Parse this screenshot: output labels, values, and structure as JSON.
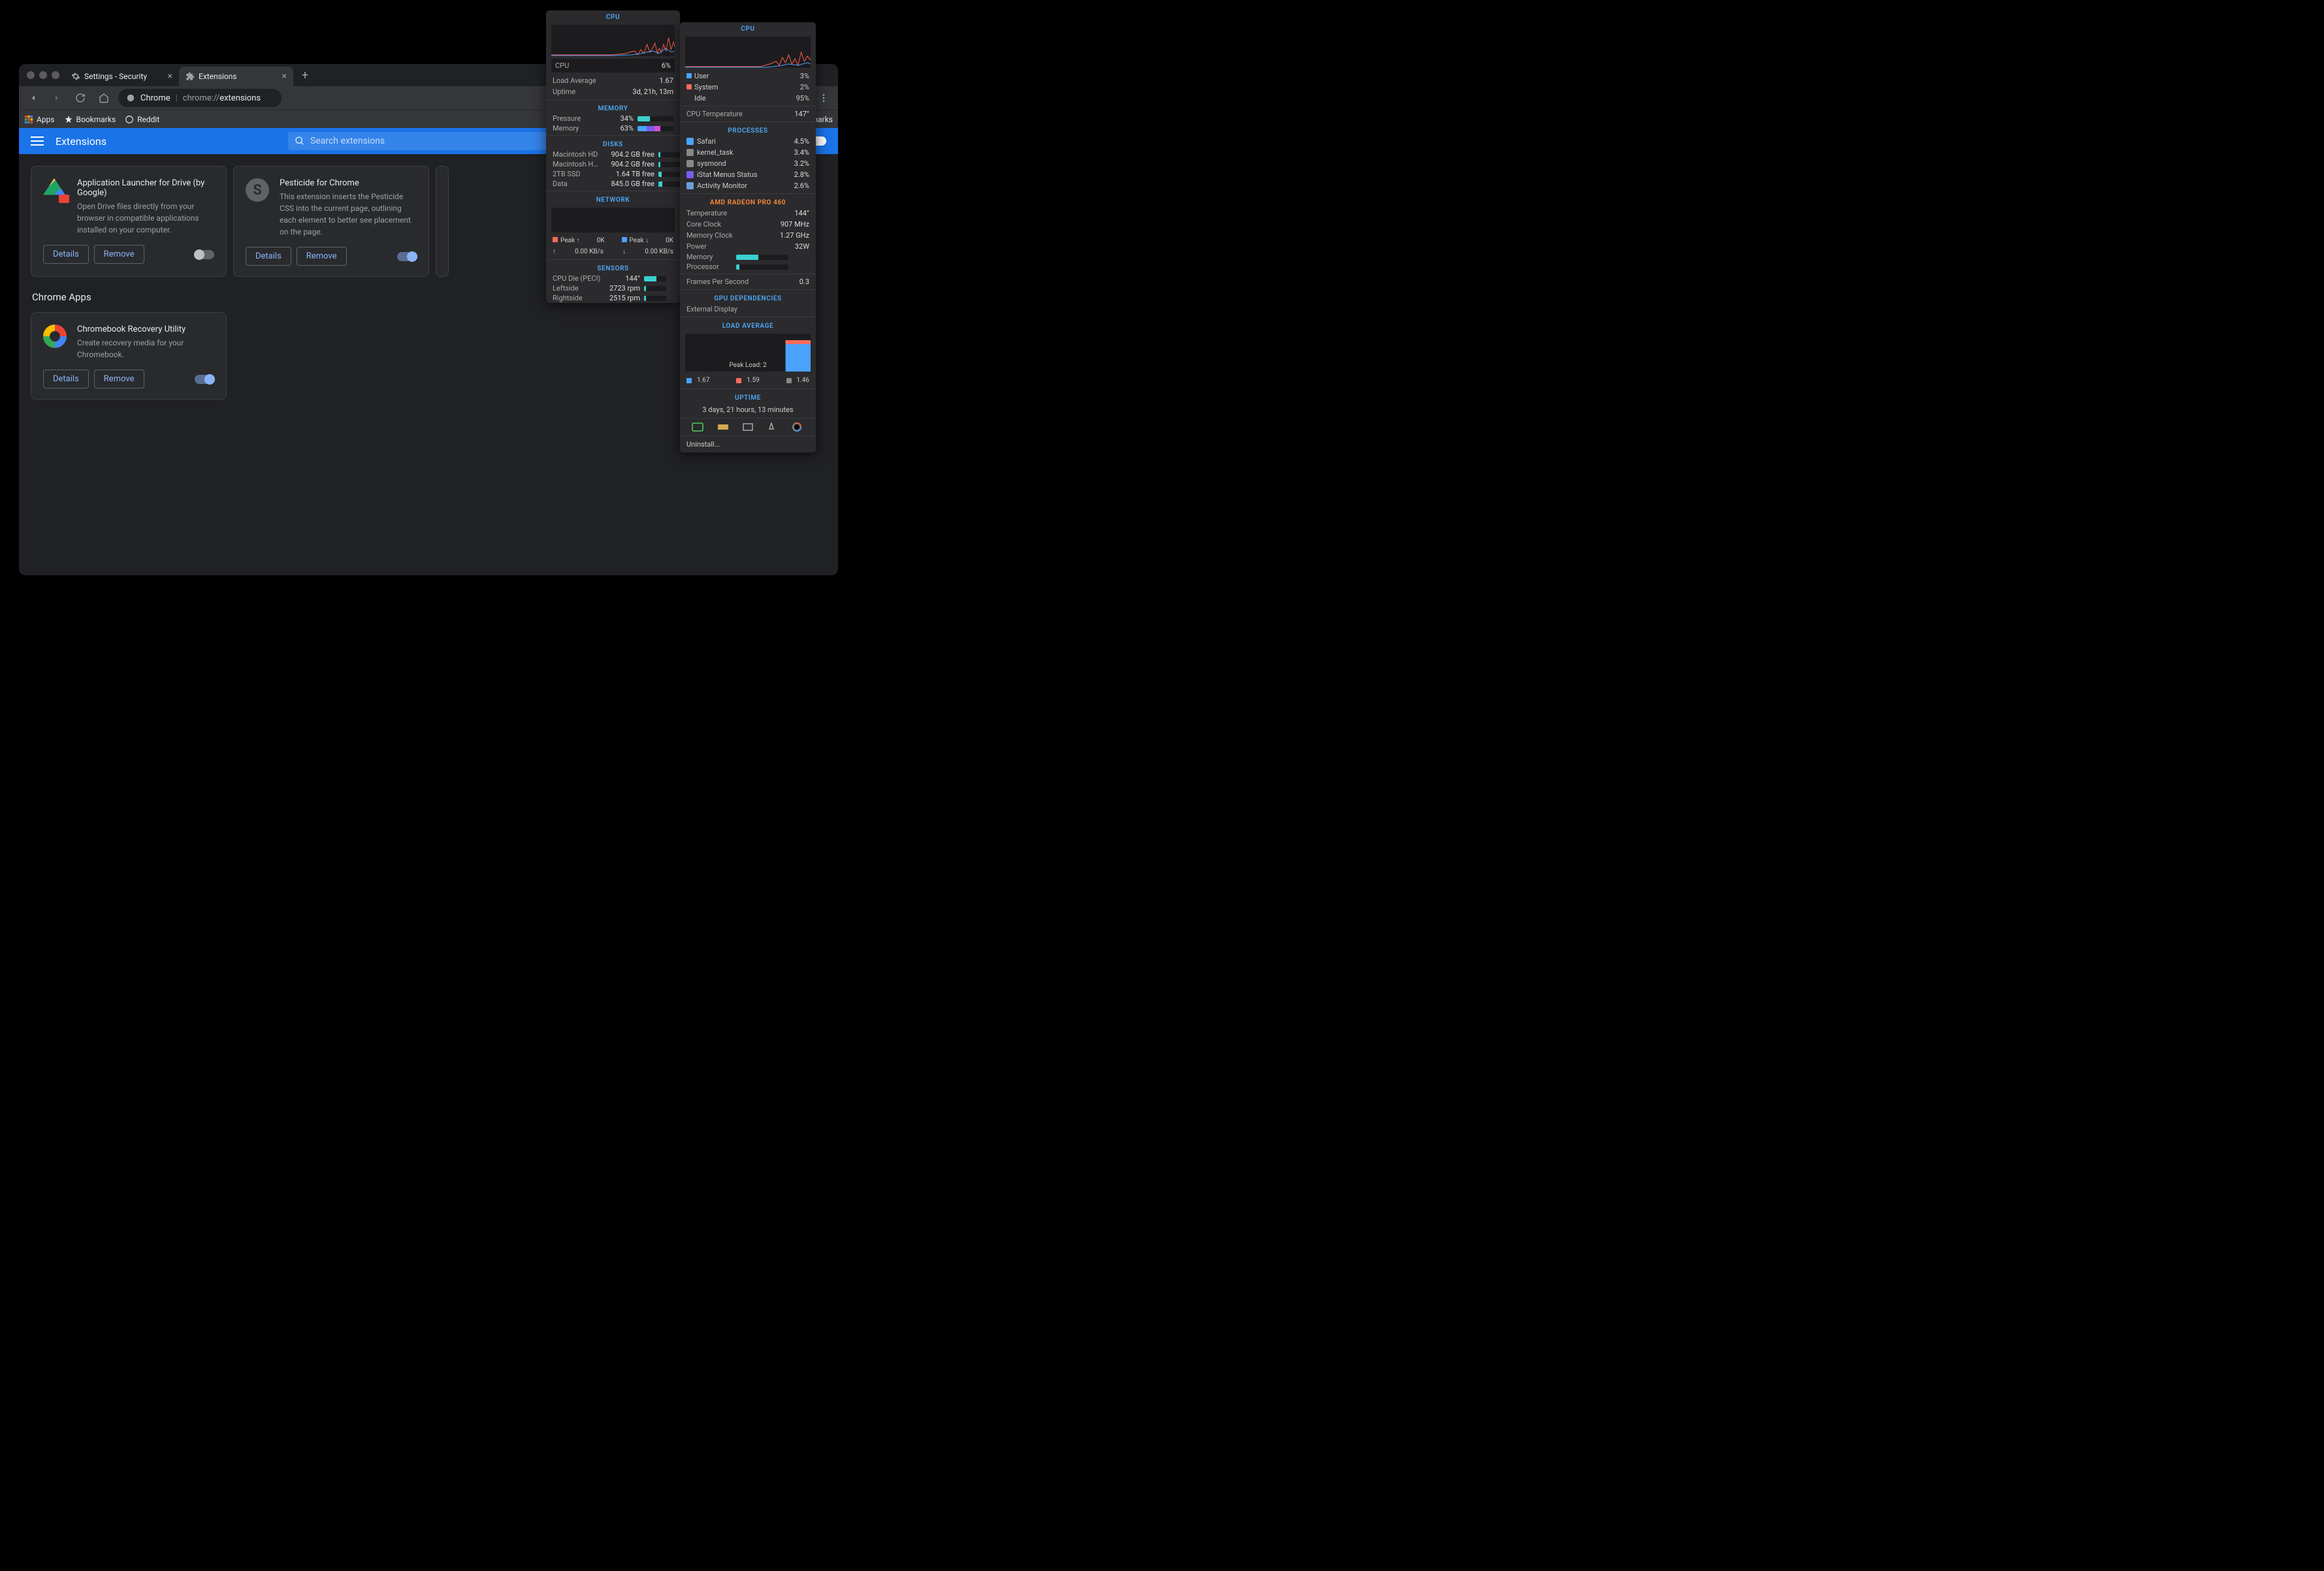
{
  "tabs": [
    {
      "title": "Settings - Security",
      "icon": "gear"
    },
    {
      "title": "Extensions",
      "icon": "puzzle",
      "active": true
    }
  ],
  "url": {
    "prefix": "Chrome",
    "dim": "chrome://",
    "main": "extensions"
  },
  "bookmarks_bar": {
    "apps": "Apps",
    "bookmarks": "Bookmarks",
    "reddit": "Reddit",
    "other": "marks"
  },
  "ext_header": {
    "title": "Extensions",
    "search_placeholder": "Search extensions"
  },
  "extensions": [
    {
      "name": "Application Launcher for Drive (by Google)",
      "desc": "Open Drive files directly from your browser in compatible applications installed on your computer.",
      "enabled": false,
      "icon": "drive"
    },
    {
      "name": "Pesticide for Chrome",
      "desc": "This extension inserts the Pesticide CSS into the current page, outlining each element to better see placement on the page.",
      "enabled": true,
      "icon": "pesticide"
    }
  ],
  "section_chrome_apps": "Chrome Apps",
  "apps": [
    {
      "name": "Chromebook Recovery Utility",
      "desc": "Create recovery media for your Chromebook.",
      "enabled": true,
      "icon": "recovery"
    }
  ],
  "buttons": {
    "details": "Details",
    "remove": "Remove"
  },
  "istat1": {
    "cpu": {
      "title": "CPU",
      "pct": "6%",
      "load_label": "Load Average",
      "load_val": "1.67",
      "uptime_label": "Uptime",
      "uptime_val": "3d, 21h, 13m"
    },
    "memory": {
      "title": "MEMORY",
      "pressure_label": "Pressure",
      "pressure_val": "34%",
      "memory_label": "Memory",
      "memory_val": "63%"
    },
    "disks": {
      "title": "DISKS",
      "items": [
        {
          "label": "Macintosh HD",
          "val": "904.2 GB free",
          "pct": 8
        },
        {
          "label": "Macintosh HD…",
          "val": "904.2 GB free",
          "pct": 8
        },
        {
          "label": "2TB SSD",
          "val": "1.64 TB free",
          "pct": 15
        },
        {
          "label": "Data",
          "val": "845.0 GB free",
          "pct": 18
        }
      ]
    },
    "network": {
      "title": "NETWORK",
      "peak_up_label": "Peak ↑",
      "peak_up_val": "0K",
      "peak_down_label": "Peak ↓",
      "peak_down_val": "0K",
      "rate_up": "0.00 KB/s",
      "rate_down": "0.00 KB/s"
    },
    "sensors": {
      "title": "SENSORS",
      "items": [
        {
          "label": "CPU Die (PECI)",
          "val": "144°",
          "pct": 55
        },
        {
          "label": "Leftside",
          "val": "2723 rpm",
          "pct": 8
        },
        {
          "label": "Rightside",
          "val": "2515 rpm",
          "pct": 8
        }
      ]
    }
  },
  "istat2": {
    "cpu": {
      "title": "CPU",
      "user_label": "User",
      "user_val": "3%",
      "system_label": "System",
      "system_val": "2%",
      "idle_label": "Idle",
      "idle_val": "95%",
      "temp_label": "CPU Temperature",
      "temp_val": "147°"
    },
    "processes": {
      "title": "PROCESSES",
      "items": [
        {
          "name": "Safari",
          "val": "4.5%",
          "color": "#4aa3ff"
        },
        {
          "name": "kernel_task",
          "val": "3.4%",
          "color": "#888"
        },
        {
          "name": "sysmond",
          "val": "3.2%",
          "color": "#888"
        },
        {
          "name": "iStat Menus Status",
          "val": "2.8%",
          "color": "#7a5cf0"
        },
        {
          "name": "Activity Monitor",
          "val": "2.6%",
          "color": "#6aa0d8"
        }
      ]
    },
    "gpu": {
      "title": "AMD RADEON PRO 460",
      "items": [
        {
          "label": "Temperature",
          "val": "144°"
        },
        {
          "label": "Core Clock",
          "val": "907 MHz"
        },
        {
          "label": "Memory Clock",
          "val": "1.27 GHz"
        },
        {
          "label": "Power",
          "val": "32W"
        }
      ],
      "memory_label": "Memory",
      "memory_pct": 42,
      "proc_label": "Processor",
      "proc_pct": 6,
      "fps_label": "Frames Per Second",
      "fps_val": "0.3"
    },
    "deps": {
      "title": "GPU DEPENDENCIES",
      "item": "External Display"
    },
    "load": {
      "title": "LOAD AVERAGE",
      "peak": "Peak Load: 2",
      "items": [
        {
          "val": "1.67",
          "color": "#4aa3ff"
        },
        {
          "val": "1.59",
          "color": "#ff6b5b"
        },
        {
          "val": "1.46",
          "color": "#888"
        }
      ]
    },
    "uptime": {
      "title": "UPTIME",
      "text": "3 days, 21 hours, 13 minutes"
    },
    "uninstall": "Uninstall..."
  }
}
